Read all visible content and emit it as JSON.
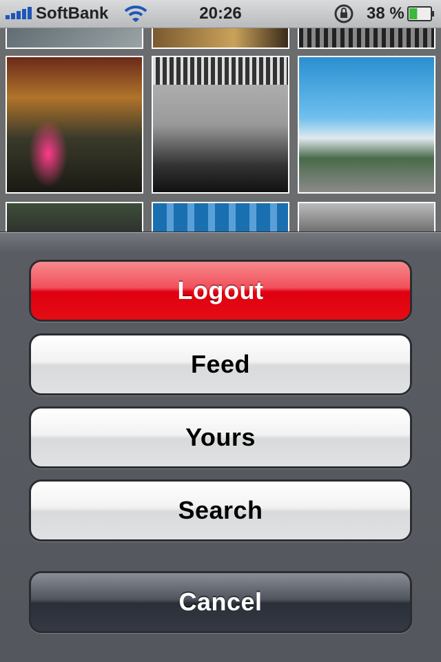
{
  "status_bar": {
    "carrier": "SoftBank",
    "time": "20:26",
    "battery_percent": "38 %",
    "battery_level": 0.38,
    "icons": [
      "signal-icon",
      "wifi-icon",
      "rotation-lock-icon",
      "battery-icon"
    ]
  },
  "action_sheet": {
    "buttons": [
      {
        "label": "Logout"
      },
      {
        "label": "Feed"
      },
      {
        "label": "Yours"
      },
      {
        "label": "Search"
      }
    ],
    "cancel_label": "Cancel"
  },
  "colors": {
    "destructive": "#e00010",
    "cancel": "#2a2f38",
    "status_bar": "#c8cacc",
    "battery_fill": "#3cb83c"
  }
}
